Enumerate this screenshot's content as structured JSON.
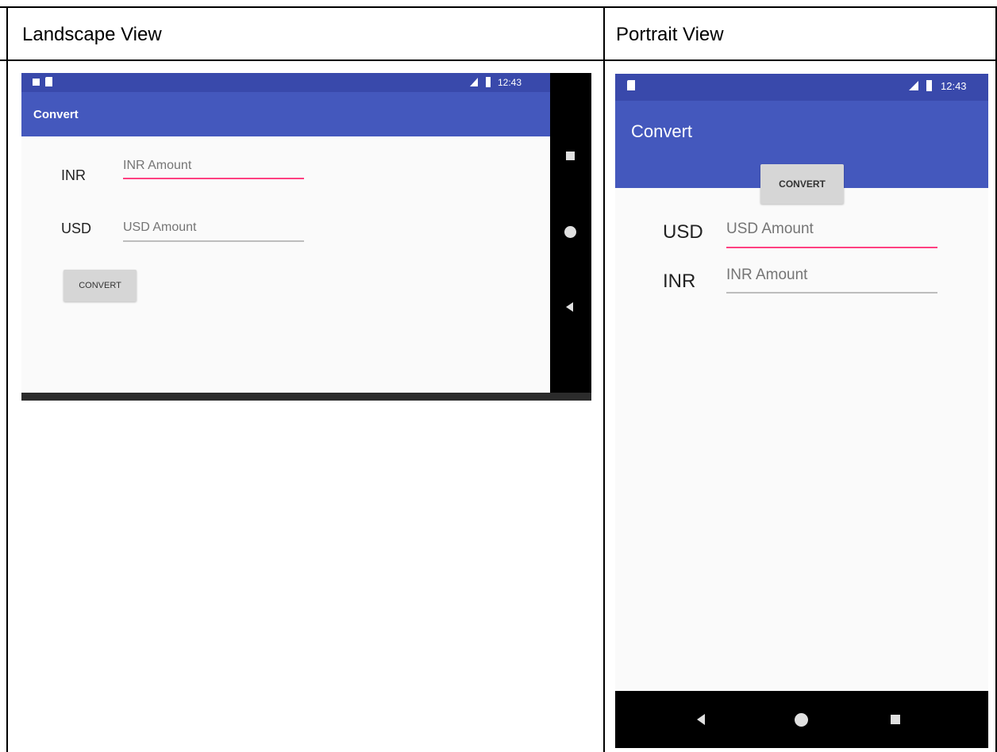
{
  "table": {
    "col1_header": "Landscape View",
    "col2_header": "Portrait View"
  },
  "landscape": {
    "status_time": "12:43",
    "app_title": "Convert",
    "inr_label": "INR",
    "inr_placeholder": "INR Amount",
    "usd_label": "USD",
    "usd_placeholder": "USD Amount",
    "convert_label": "CONVERT"
  },
  "portrait": {
    "status_time": "12:43",
    "app_title": "Convert",
    "convert_label": "CONVERT",
    "usd_label": "USD",
    "usd_placeholder": "USD Amount",
    "inr_label": "INR",
    "inr_placeholder": "INR Amount"
  },
  "colors": {
    "status_bar": "#3949ab",
    "app_bar": "#4458bd",
    "accent": "#ff4081"
  },
  "icons": [
    "sim-card-icon",
    "notification-icon",
    "signal-icon",
    "battery-icon",
    "back-icon",
    "home-icon",
    "recents-icon"
  ]
}
